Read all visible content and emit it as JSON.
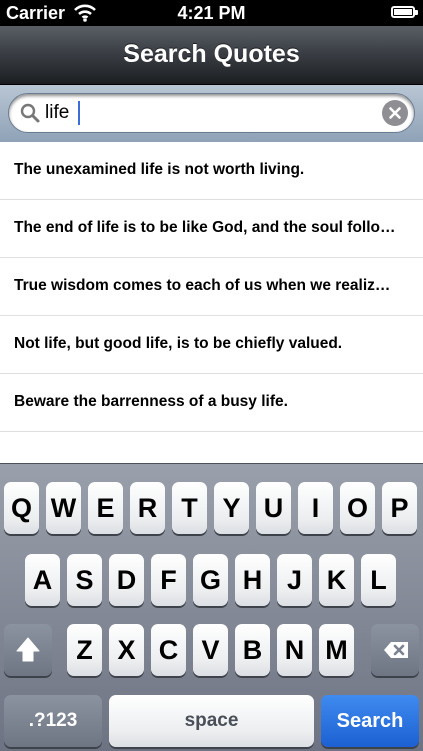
{
  "status_bar": {
    "carrier": "Carrier",
    "time": "4:21 PM"
  },
  "nav": {
    "title": "Search Quotes"
  },
  "search": {
    "value": "life",
    "placeholder": ""
  },
  "results": [
    "The unexamined life is not worth living.",
    "The end of life is to be like God, and the soul follo…",
    "True wisdom comes to each of us when we realiz…",
    "Not life, but good life, is to be chiefly valued.",
    "Beware the barrenness of a busy life."
  ],
  "keyboard": {
    "row1": [
      "Q",
      "W",
      "E",
      "R",
      "T",
      "Y",
      "U",
      "I",
      "O",
      "P"
    ],
    "row2": [
      "A",
      "S",
      "D",
      "F",
      "G",
      "H",
      "J",
      "K",
      "L"
    ],
    "row3": [
      "Z",
      "X",
      "C",
      "V",
      "B",
      "N",
      "M"
    ],
    "numbers_label": ".?123",
    "space_label": "space",
    "search_label": "Search"
  },
  "icons": {
    "wifi": "wifi-icon",
    "battery": "battery-icon",
    "search": "search-icon",
    "clear": "clear-icon",
    "shift": "shift-icon",
    "delete": "delete-icon"
  },
  "colors": {
    "search_key": "#1c60d2",
    "nav_bar": "#2a2d31"
  }
}
